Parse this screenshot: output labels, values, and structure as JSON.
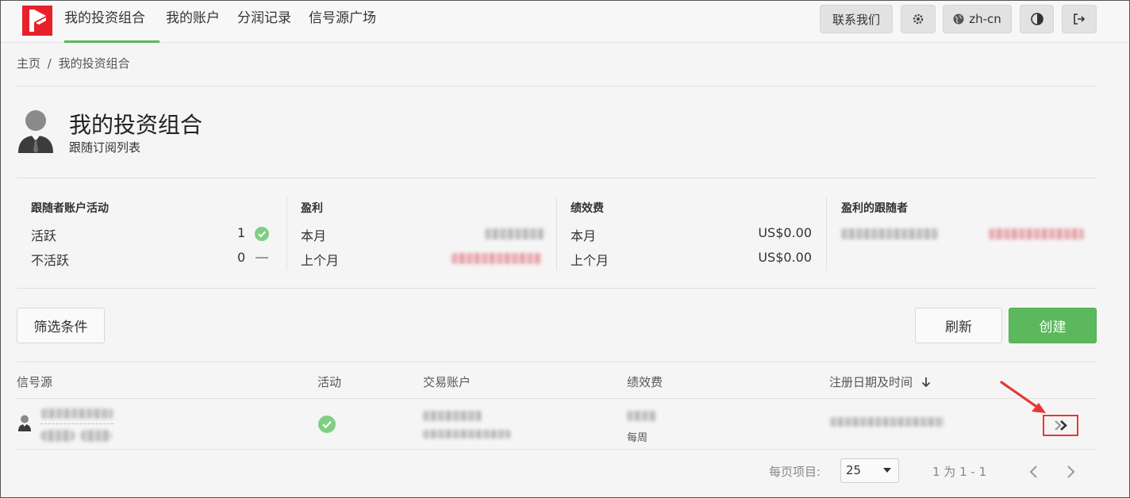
{
  "nav": {
    "items": [
      {
        "label": "我的投资组合"
      },
      {
        "label": "我的账户"
      },
      {
        "label": "分润记录"
      },
      {
        "label": "信号源广场"
      }
    ],
    "contact_label": "联系我们",
    "lang_label": "zh-cn"
  },
  "breadcrumb": {
    "home": "主页",
    "separator": "/",
    "current": "我的投资组合"
  },
  "header": {
    "title": "我的投资组合",
    "subtitle": "跟随订阅列表"
  },
  "stats": {
    "activity": {
      "title": "跟随者账户活动",
      "active_label": "活跃",
      "active_count": "1",
      "inactive_label": "不活跃",
      "inactive_count": "0"
    },
    "profit": {
      "title": "盈利",
      "this_month": "本月",
      "last_month": "上个月"
    },
    "fee": {
      "title": "绩效费",
      "this_month": "本月",
      "this_month_value": "US$0.00",
      "last_month": "上个月",
      "last_month_value": "US$0.00"
    },
    "profitable": {
      "title": "盈利的跟随者"
    }
  },
  "actions": {
    "filter_label": "筛选条件",
    "refresh_label": "刷新",
    "create_label": "创建"
  },
  "table": {
    "headers": {
      "signal": "信号源",
      "active": "活动",
      "account": "交易账户",
      "fee": "绩效费",
      "registered": "注册日期及时间"
    },
    "rows": [
      {
        "fee_period": "每周"
      }
    ]
  },
  "pagination": {
    "per_page_label": "每页项目:",
    "per_page_value": "25",
    "range_label": "1 为 1 - 1"
  },
  "colors": {
    "accent": "#5cb85c",
    "brand": "#e8202a",
    "annotation": "#e53935"
  },
  "icons": [
    "logo",
    "gear-icon",
    "globe-icon",
    "contrast-icon",
    "logout-icon",
    "avatar-icon",
    "check-icon",
    "dash-icon",
    "sort-down-icon",
    "double-chevron-right-icon",
    "chevron-left-icon",
    "chevron-right-icon"
  ]
}
